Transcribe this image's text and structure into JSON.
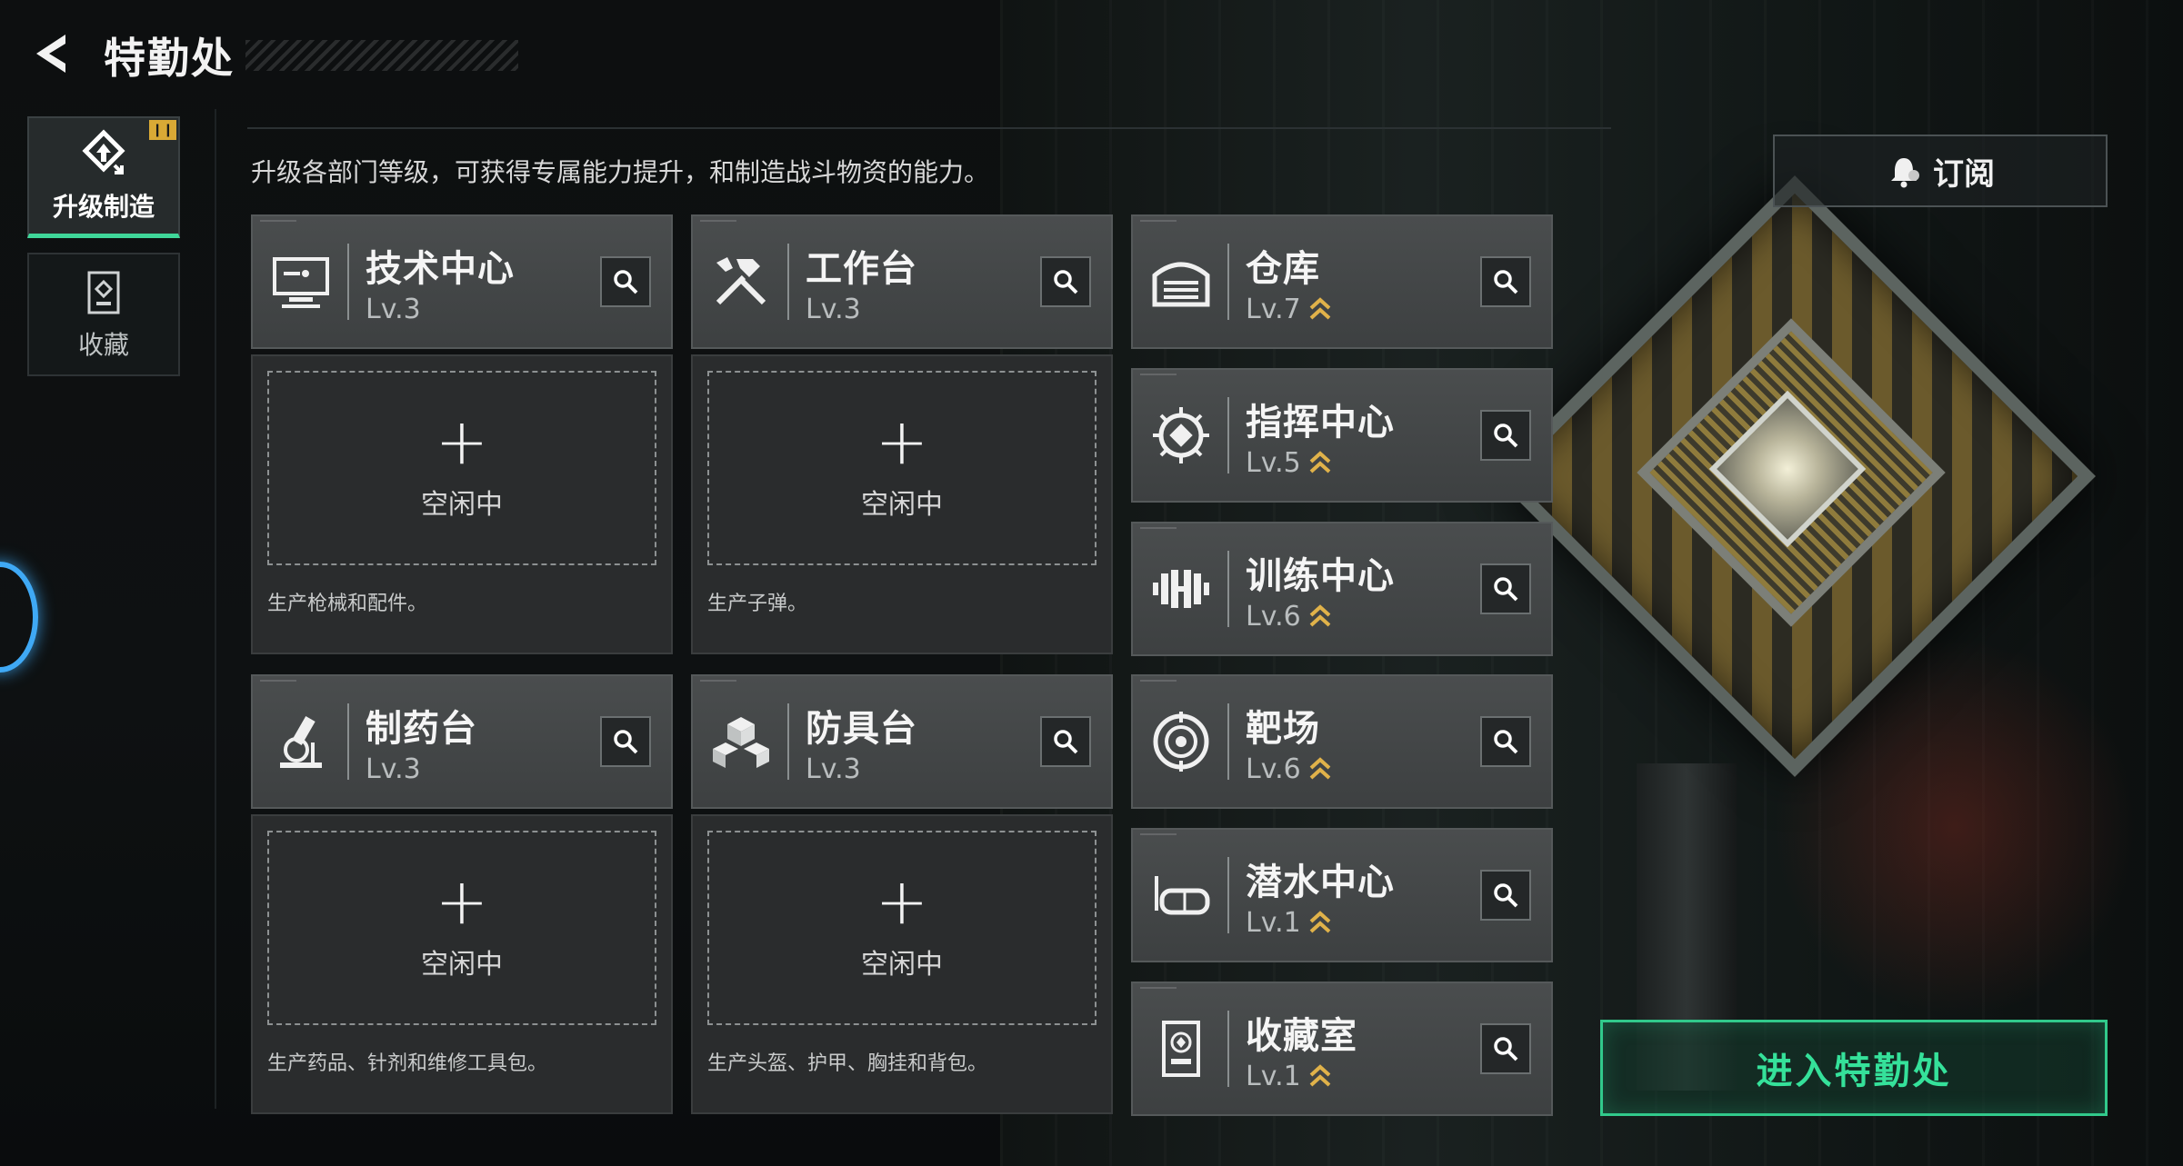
{
  "header": {
    "title": "特勤处",
    "back_icon": "back-arrow-icon"
  },
  "sidebar": {
    "tabs": [
      {
        "label": "升级制造",
        "icon": "upgrade-icon",
        "active": true,
        "badge": ""
      },
      {
        "label": "收藏",
        "icon": "collection-icon",
        "active": false
      }
    ]
  },
  "description": "升级各部门等级，可获得专属能力提升，和制造战斗物资的能力。",
  "subscribe": {
    "label": "订阅",
    "icon": "bell-icon"
  },
  "production": [
    {
      "name": "技术中心",
      "level": "Lv.3",
      "icon": "computer-icon",
      "slot_label": "空闲中",
      "desc": "生产枪械和配件。"
    },
    {
      "name": "工作台",
      "level": "Lv.3",
      "icon": "tools-icon",
      "slot_label": "空闲中",
      "desc": "生产子弹。"
    },
    {
      "name": "制药台",
      "level": "Lv.3",
      "icon": "microscope-icon",
      "slot_label": "空闲中",
      "desc": "生产药品、针剂和维修工具包。"
    },
    {
      "name": "防具台",
      "level": "Lv.3",
      "icon": "armor-blocks-icon",
      "slot_label": "空闲中",
      "desc": "生产头盔、护甲、胸挂和背包。"
    }
  ],
  "facilities": [
    {
      "name": "仓库",
      "level": "Lv.7",
      "icon": "warehouse-icon"
    },
    {
      "name": "指挥中心",
      "level": "Lv.5",
      "icon": "chip-icon"
    },
    {
      "name": "训练中心",
      "level": "Lv.6",
      "icon": "dumbbell-icon"
    },
    {
      "name": "靶场",
      "level": "Lv.6",
      "icon": "target-icon"
    },
    {
      "name": "潜水中心",
      "level": "Lv.1",
      "icon": "diving-mask-icon"
    },
    {
      "name": "收藏室",
      "level": "Lv.1",
      "icon": "collection-room-icon"
    }
  ],
  "enter_button": {
    "label": "进入特勤处"
  },
  "colors": {
    "accent": "#35e19a",
    "upgrade_chevron": "#e0b24a",
    "badge": "#d9a935"
  }
}
